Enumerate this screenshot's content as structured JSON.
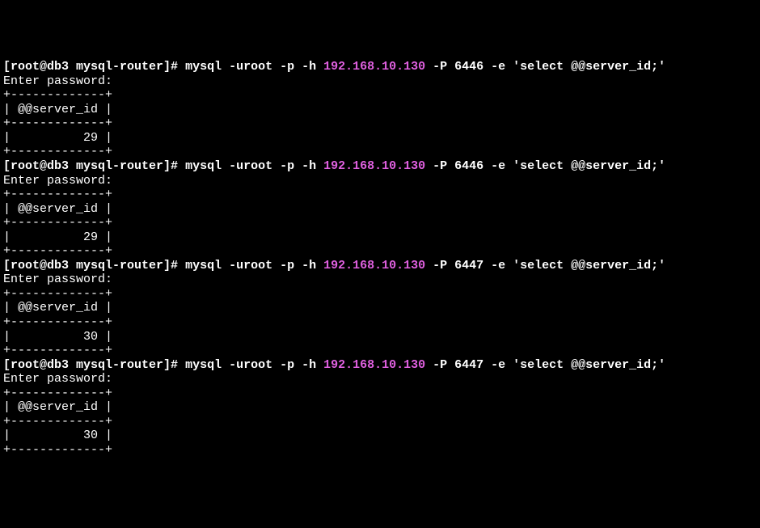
{
  "blocks": [
    {
      "prompt_open": "[",
      "prompt_user_host": "root@db3 mysql-router",
      "prompt_close": "]# ",
      "cmd_before_ip": "mysql -uroot -p -h ",
      "ip": "192.168.10.130",
      "cmd_after_ip": " -P 6446 -e 'select @@server_id;'",
      "password_prompt": "Enter password:",
      "border": "+-------------+",
      "header_row": "| @@server_id |",
      "value_row": "|          29 |"
    },
    {
      "prompt_open": "[",
      "prompt_user_host": "root@db3 mysql-router",
      "prompt_close": "]# ",
      "cmd_before_ip": "mysql -uroot -p -h ",
      "ip": "192.168.10.130",
      "cmd_after_ip": " -P 6446 -e 'select @@server_id;'",
      "password_prompt": "Enter password:",
      "border": "+-------------+",
      "header_row": "| @@server_id |",
      "value_row": "|          29 |"
    },
    {
      "prompt_open": "[",
      "prompt_user_host": "root@db3 mysql-router",
      "prompt_close": "]# ",
      "cmd_before_ip": "mysql -uroot -p -h ",
      "ip": "192.168.10.130",
      "cmd_after_ip": " -P 6447 -e 'select @@server_id;'",
      "password_prompt": "Enter password:",
      "border": "+-------------+",
      "header_row": "| @@server_id |",
      "value_row": "|          30 |"
    },
    {
      "prompt_open": "[",
      "prompt_user_host": "root@db3 mysql-router",
      "prompt_close": "]# ",
      "cmd_before_ip": "mysql -uroot -p -h ",
      "ip": "192.168.10.130",
      "cmd_after_ip": " -P 6447 -e 'select @@server_id;'",
      "password_prompt": "Enter password:",
      "border": "+-------------+",
      "header_row": "| @@server_id |",
      "value_row": "|          30 |"
    }
  ]
}
